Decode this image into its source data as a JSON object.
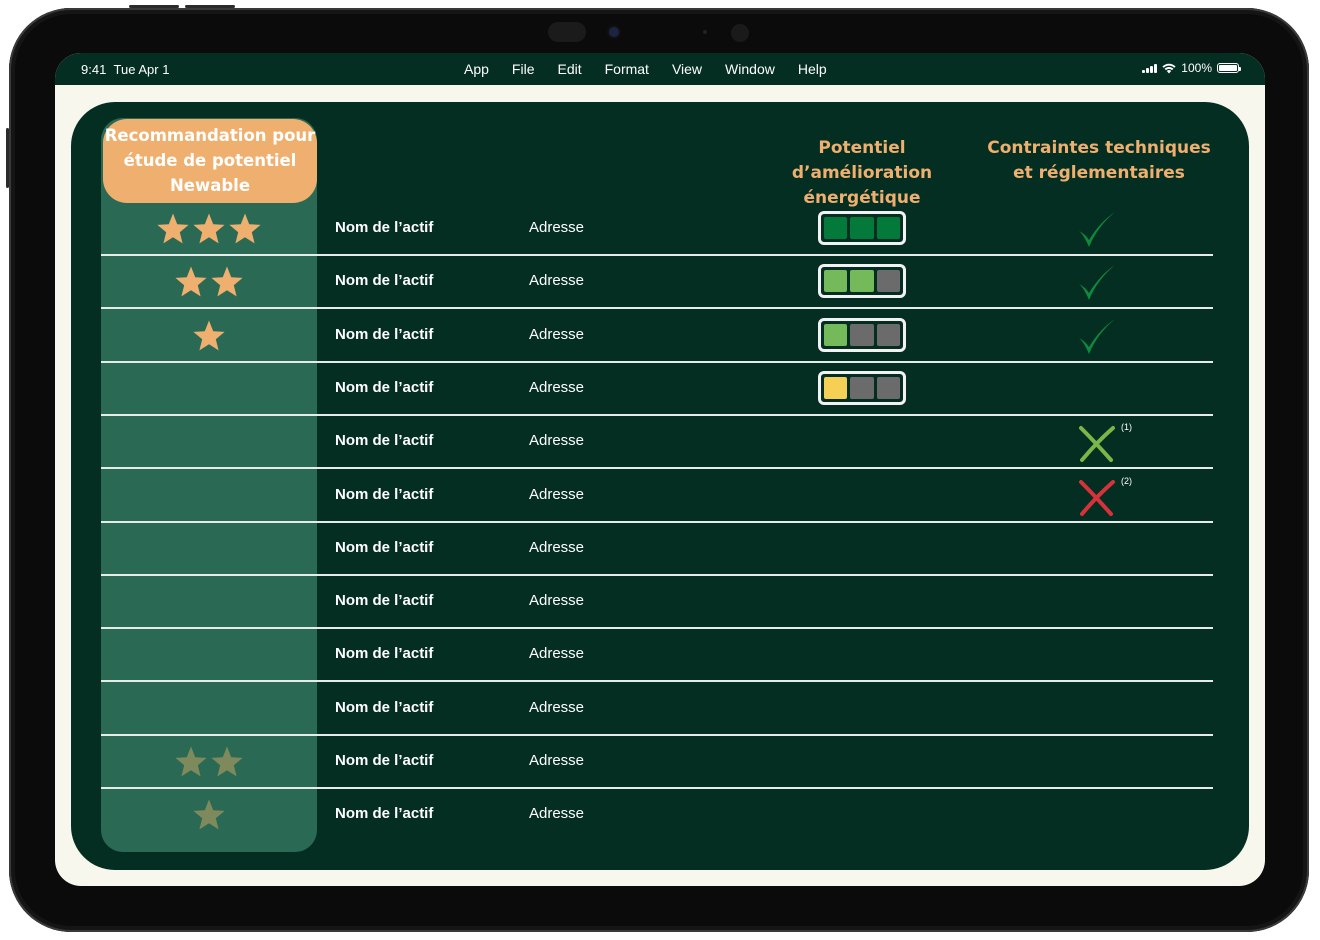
{
  "statusbar": {
    "time": "9:41",
    "date": "Tue Apr 1",
    "menu": [
      "App",
      "File",
      "Edit",
      "Format",
      "View",
      "Window",
      "Help"
    ],
    "battery": "100%"
  },
  "table": {
    "header_recommendation": "Recommandation pour étude de potentiel Newable",
    "header_potential": "Potentiel d’amélioration énergétique",
    "header_constraints": "Contraintes techniques et réglementaires",
    "rows": [
      {
        "name": "Nom de l’actif",
        "address": "Adresse",
        "stars": 3,
        "star_style": "highlight",
        "gauge": [
          "dark-green",
          "dark-green",
          "dark-green"
        ],
        "constraint": "check",
        "note": ""
      },
      {
        "name": "Nom de l’actif",
        "address": "Adresse",
        "stars": 2,
        "star_style": "highlight",
        "gauge": [
          "light-green",
          "light-green",
          "grey"
        ],
        "constraint": "check",
        "note": ""
      },
      {
        "name": "Nom de l’actif",
        "address": "Adresse",
        "stars": 1,
        "star_style": "highlight",
        "gauge": [
          "light-green",
          "grey",
          "grey"
        ],
        "constraint": "check",
        "note": ""
      },
      {
        "name": "Nom de l’actif",
        "address": "Adresse",
        "stars": 0,
        "star_style": "highlight",
        "gauge": [
          "yellow",
          "grey",
          "grey"
        ],
        "constraint": "none",
        "note": ""
      },
      {
        "name": "Nom de l’actif",
        "address": "Adresse",
        "stars": 0,
        "star_style": "highlight",
        "gauge": [],
        "constraint": "cross-green",
        "note": "(1)"
      },
      {
        "name": "Nom de l’actif",
        "address": "Adresse",
        "stars": 0,
        "star_style": "highlight",
        "gauge": [],
        "constraint": "cross-red",
        "note": "(2)"
      },
      {
        "name": "Nom de l’actif",
        "address": "Adresse",
        "stars": 0,
        "star_style": "highlight",
        "gauge": [],
        "constraint": "none",
        "note": ""
      },
      {
        "name": "Nom de l’actif",
        "address": "Adresse",
        "stars": 0,
        "star_style": "highlight",
        "gauge": [],
        "constraint": "none",
        "note": ""
      },
      {
        "name": "Nom de l’actif",
        "address": "Adresse",
        "stars": 0,
        "star_style": "highlight",
        "gauge": [],
        "constraint": "none",
        "note": ""
      },
      {
        "name": "Nom de l’actif",
        "address": "Adresse",
        "stars": 0,
        "star_style": "highlight",
        "gauge": [],
        "constraint": "none",
        "note": ""
      },
      {
        "name": "Nom de l’actif",
        "address": "Adresse",
        "stars": 2,
        "star_style": "muted",
        "gauge": [],
        "constraint": "none",
        "note": ""
      },
      {
        "name": "Nom de l’actif",
        "address": "Adresse",
        "stars": 1,
        "star_style": "muted",
        "gauge": [],
        "constraint": "none",
        "note": ""
      }
    ]
  },
  "colors": {
    "background_dark": "#052e22",
    "reco_column": "#2a6a55",
    "accent_orange": "#efb06f",
    "star_highlight": "#efb06f",
    "star_muted": "#7f8a5c",
    "dark-green": "#047a3a",
    "light-green": "#74b95a",
    "grey": "#6b6b6b",
    "yellow": "#f6cf55",
    "check": "#0e8a3c",
    "cross-green": "#7ab648",
    "cross-red": "#d7323a"
  }
}
